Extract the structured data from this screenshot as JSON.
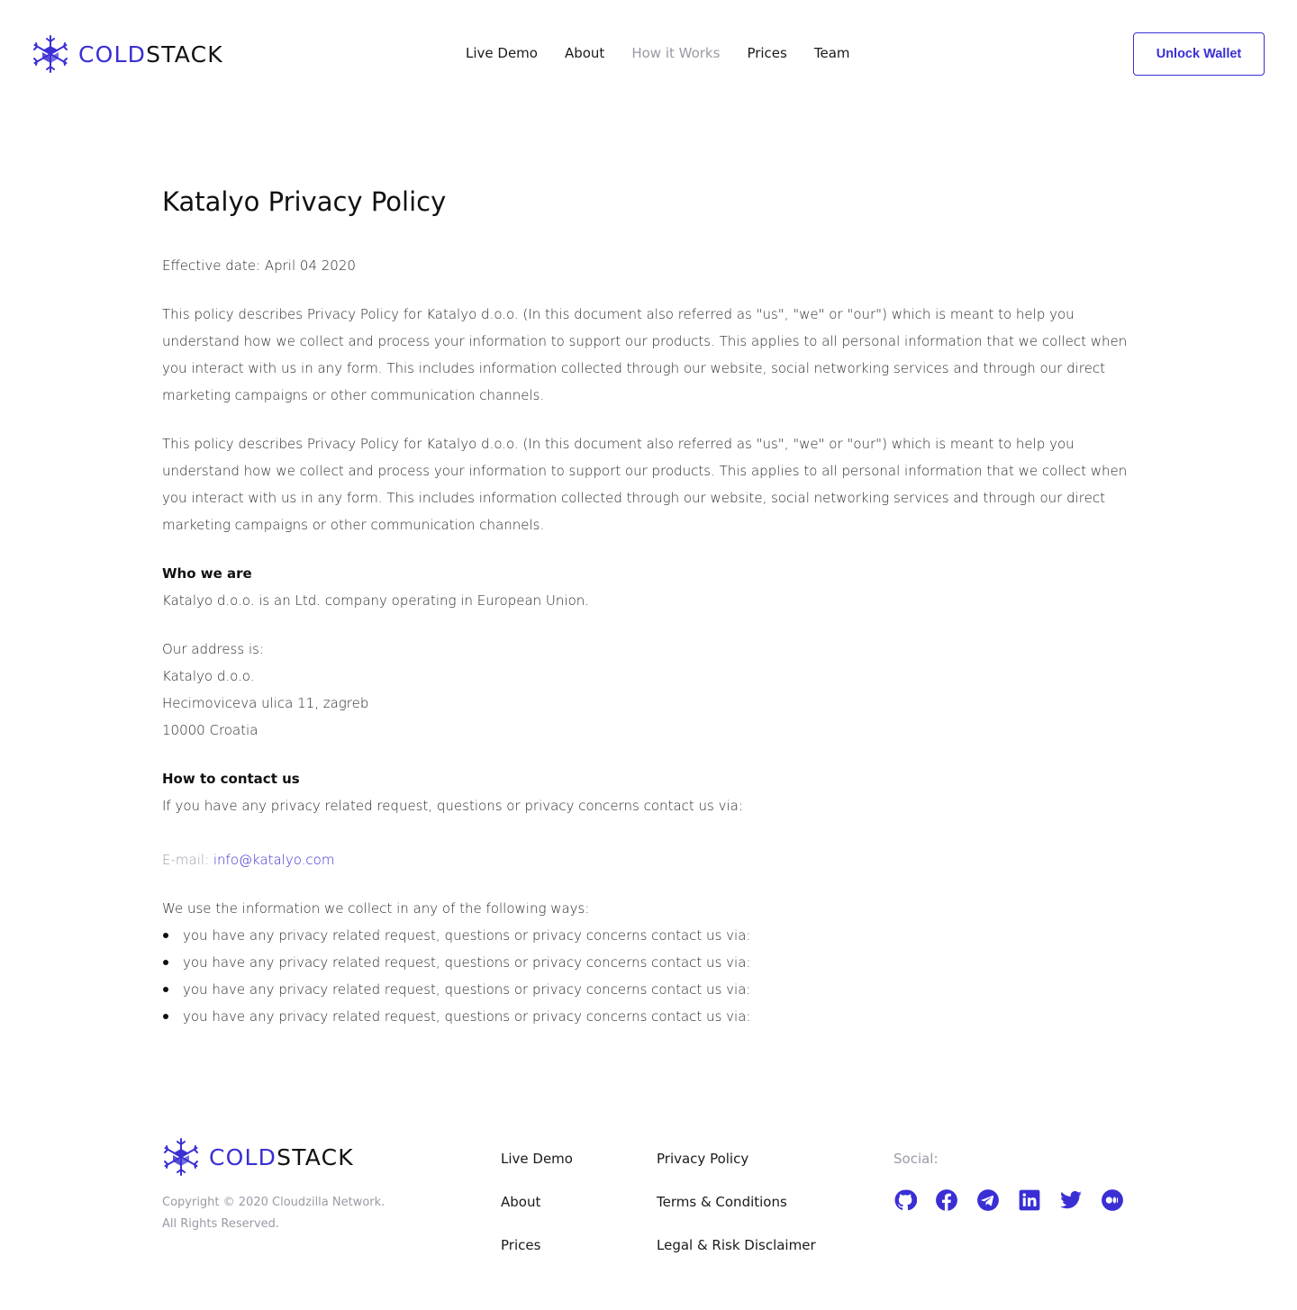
{
  "brand": {
    "name_part1": "COLD",
    "name_part2": "STACK",
    "accent_color": "#3a2fd4"
  },
  "nav": {
    "items": [
      {
        "label": "Live Demo"
      },
      {
        "label": "About"
      },
      {
        "label": "How it Works",
        "active": true
      },
      {
        "label": "Prices"
      },
      {
        "label": "Team"
      }
    ],
    "unlock_label": "Unlock Wallet"
  },
  "main": {
    "title": "Katalyo Privacy Policy",
    "effective_date": "Effective date: April 04 2020",
    "paragraphs": [
      "This policy describes Privacy Policy for Katalyo d.o.o. (In this document also referred as \"us\", \"we\" or \"our\") which is meant to help you understand how we collect and process your information to support our products. This applies to all personal information that we collect when you interact with us in any form. This includes information collected through our website, social networking services and through our direct marketing campaigns or other communication channels.",
      "This policy describes Privacy Policy for Katalyo d.o.o. (In this document also referred as \"us\", \"we\" or \"our\") which is meant to help you understand how we collect and process your information to support our products. This applies to all personal information that we collect when you interact with us in any form. This includes information collected through our website, social networking services and through our direct marketing campaigns or other communication channels."
    ],
    "who_heading": "Who we are",
    "who_text": "Katalyo d.o.o. is an Ltd. company operating in European Union.",
    "address_lines": [
      "Our address is:",
      "Katalyo d.o.o.",
      "Hecimoviceva ulica 11, zagreb",
      "10000 Croatia"
    ],
    "contact_heading": "How to contact us",
    "contact_text": "If you have any privacy related request, questions or privacy concerns contact us via:",
    "email_label": "E-mail: ",
    "email": "info@katalyo.com",
    "use_intro": "We use the information we collect in any of the following ways:",
    "use_items": [
      "you have any privacy related request, questions or privacy concerns contact us via:",
      "you have any privacy related request, questions or privacy concerns contact us via:",
      "you have any privacy related request, questions or privacy concerns contact us via:",
      "you have any privacy related request, questions or privacy concerns contact us via:"
    ]
  },
  "footer": {
    "copyright_line1": "Copyright © 2020 Cloudzilla Network.",
    "copyright_line2": "All Rights Reserved.",
    "col1": [
      "Live Demo",
      "About",
      "Prices"
    ],
    "col2": [
      "Privacy Policy",
      "Terms & Conditions",
      "Legal & Risk Disclaimer"
    ],
    "social_label": "Social:",
    "social_icons": [
      "github-icon",
      "facebook-icon",
      "telegram-icon",
      "linkedin-icon",
      "twitter-icon",
      "medium-icon"
    ]
  }
}
